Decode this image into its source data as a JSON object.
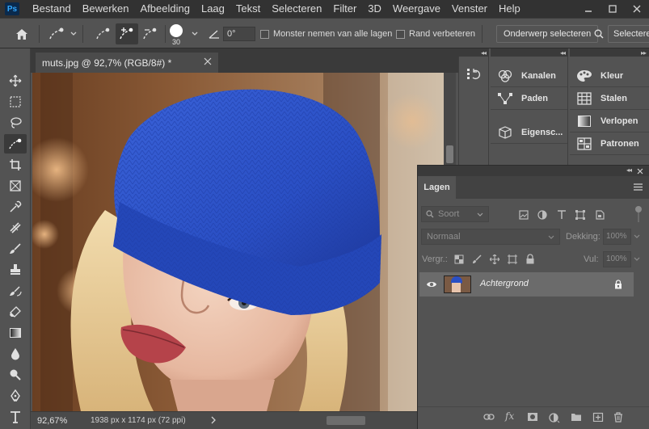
{
  "app": {
    "logo_text": "Ps"
  },
  "menu": [
    "Bestand",
    "Bewerken",
    "Afbeelding",
    "Laag",
    "Tekst",
    "Selecteren",
    "Filter",
    "3D",
    "Weergave",
    "Venster",
    "Help"
  ],
  "options": {
    "brush_size": "30",
    "angle_value": "0°",
    "sample_all_layers_label": "Monster nemen van alle lagen",
    "enhance_edge_label": "Rand verbeteren",
    "select_subject_label": "Onderwerp selecteren",
    "select_mask_label": "Selecteren"
  },
  "document": {
    "tab_title": "muts.jpg @ 92,7% (RGB/8#) *",
    "zoom": "92,67%",
    "info": "1938 px x 1174 px (72 ppi)"
  },
  "panels": {
    "col1": [
      {
        "label": "Kanalen",
        "icon": "channels-icon"
      },
      {
        "label": "Paden",
        "icon": "paths-icon"
      },
      {
        "label": "Eigensc...",
        "icon": "properties-icon"
      }
    ],
    "col2": [
      {
        "label": "Kleur",
        "icon": "color-palette-icon"
      },
      {
        "label": "Stalen",
        "icon": "swatches-icon"
      },
      {
        "label": "Verlopen",
        "icon": "gradients-icon"
      },
      {
        "label": "Patronen",
        "icon": "patterns-icon"
      }
    ]
  },
  "layers": {
    "tab_label": "Lagen",
    "filter_placeholder": "Soort",
    "blend_mode": "Normaal",
    "opacity_label": "Dekking:",
    "opacity_value": "100%",
    "lock_label": "Vergr.:",
    "fill_label": "Vul:",
    "fill_value": "100%",
    "items": [
      {
        "name": "Achtergrond",
        "visible": true,
        "locked": true
      }
    ]
  },
  "colors": {
    "accent": "#31a8ff",
    "hat": "#2a4fc4",
    "panel_bg": "#535353",
    "dark_bg": "#323232"
  }
}
